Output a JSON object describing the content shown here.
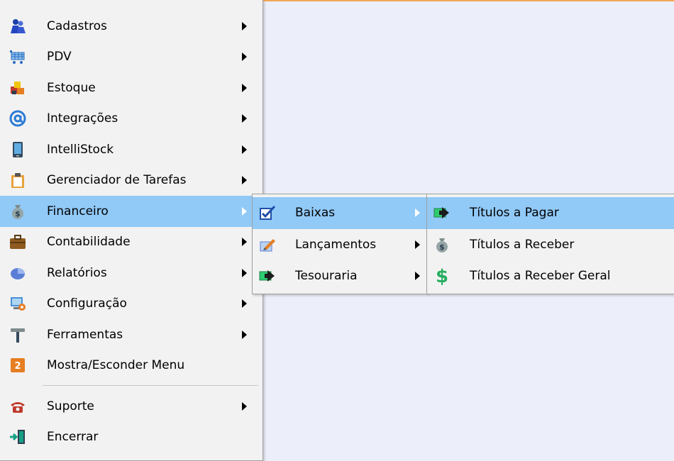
{
  "colors": {
    "background": "#eceff9",
    "menu_bg": "#f2f2f2",
    "highlight": "#91c9f7",
    "accent_line": "#f0a656"
  },
  "main_menu": {
    "items": [
      {
        "label": "Cadastros",
        "icon": "users-icon",
        "submenu": true
      },
      {
        "label": "PDV",
        "icon": "cart-icon",
        "submenu": true
      },
      {
        "label": "Estoque",
        "icon": "boxes-icon",
        "submenu": true
      },
      {
        "label": "Integrações",
        "icon": "at-sign-icon",
        "submenu": true
      },
      {
        "label": "IntelliStock",
        "icon": "phone-device-icon",
        "submenu": true
      },
      {
        "label": "Gerenciador de Tarefas",
        "icon": "clipboard-icon",
        "submenu": true
      },
      {
        "label": "Financeiro",
        "icon": "money-bag-icon",
        "submenu": true,
        "highlighted": true
      },
      {
        "label": "Contabilidade",
        "icon": "briefcase-icon",
        "submenu": true
      },
      {
        "label": "Relatórios",
        "icon": "pie-chart-icon",
        "submenu": true
      },
      {
        "label": "Configuração",
        "icon": "settings-computer-icon",
        "submenu": true
      },
      {
        "label": "Ferramentas",
        "icon": "hammer-icon",
        "submenu": true
      },
      {
        "label": "Mostra/Esconder Menu",
        "icon": "toggle-menu-icon",
        "submenu": false
      }
    ],
    "bottom_items": [
      {
        "label": "Suporte",
        "icon": "telephone-icon",
        "submenu": true
      },
      {
        "label": "Encerrar",
        "icon": "exit-door-icon",
        "submenu": false
      }
    ]
  },
  "financeiro_menu": {
    "items": [
      {
        "label": "Baixas",
        "icon": "checkbox-icon",
        "submenu": true,
        "highlighted": true
      },
      {
        "label": "Lançamentos",
        "icon": "edit-pencil-icon",
        "submenu": true
      },
      {
        "label": "Tesouraria",
        "icon": "money-arrow-icon",
        "submenu": true
      }
    ]
  },
  "baixas_menu": {
    "items": [
      {
        "label": "Títulos a Pagar",
        "icon": "money-arrow-icon",
        "highlighted": true
      },
      {
        "label": "Títulos a Receber",
        "icon": "money-bag-icon"
      },
      {
        "label": "Títulos a Receber Geral",
        "icon": "dollar-sign-icon"
      }
    ]
  }
}
